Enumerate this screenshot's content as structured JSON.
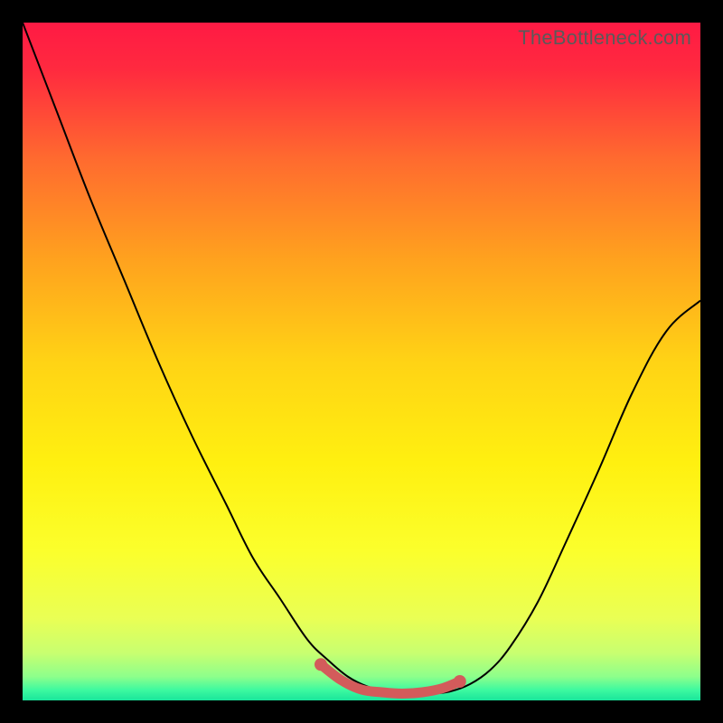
{
  "watermark": "TheBottleneck.com",
  "chart_data": {
    "type": "line",
    "title": "",
    "xlabel": "",
    "ylabel": "",
    "xlim": [
      0,
      1
    ],
    "ylim": [
      0,
      1
    ],
    "background_gradient": {
      "stops": [
        {
          "pos": 0.0,
          "color": "#ff1a44"
        },
        {
          "pos": 0.07,
          "color": "#ff2a3f"
        },
        {
          "pos": 0.2,
          "color": "#ff6a2f"
        },
        {
          "pos": 0.35,
          "color": "#ffa21e"
        },
        {
          "pos": 0.5,
          "color": "#ffd315"
        },
        {
          "pos": 0.65,
          "color": "#fff010"
        },
        {
          "pos": 0.78,
          "color": "#fbff2c"
        },
        {
          "pos": 0.88,
          "color": "#e9ff55"
        },
        {
          "pos": 0.93,
          "color": "#c8ff70"
        },
        {
          "pos": 0.965,
          "color": "#8dff8b"
        },
        {
          "pos": 0.985,
          "color": "#3cf9a0"
        },
        {
          "pos": 1.0,
          "color": "#19e59b"
        }
      ]
    },
    "curve": {
      "x": [
        0.0,
        0.05,
        0.1,
        0.15,
        0.2,
        0.25,
        0.3,
        0.34,
        0.38,
        0.42,
        0.45,
        0.48,
        0.51,
        0.54,
        0.57,
        0.6,
        0.63,
        0.66,
        0.69,
        0.72,
        0.76,
        0.8,
        0.85,
        0.9,
        0.95,
        1.0
      ],
      "y": [
        1.0,
        0.87,
        0.74,
        0.62,
        0.5,
        0.39,
        0.29,
        0.21,
        0.15,
        0.09,
        0.06,
        0.035,
        0.02,
        0.013,
        0.01,
        0.01,
        0.013,
        0.024,
        0.045,
        0.08,
        0.145,
        0.23,
        0.34,
        0.455,
        0.545,
        0.59
      ],
      "stroke": "#000000",
      "stroke_width": 2
    },
    "highlight_segment": {
      "x": [
        0.44,
        0.47,
        0.5,
        0.53,
        0.56,
        0.59,
        0.62,
        0.645
      ],
      "y": [
        0.053,
        0.03,
        0.016,
        0.012,
        0.01,
        0.012,
        0.018,
        0.028
      ],
      "stroke": "#d35b5b",
      "stroke_width": 11
    },
    "highlight_endpoints": {
      "points": [
        {
          "x": 0.44,
          "y": 0.053
        },
        {
          "x": 0.645,
          "y": 0.028
        }
      ],
      "fill": "#d35b5b",
      "radius": 7
    }
  }
}
